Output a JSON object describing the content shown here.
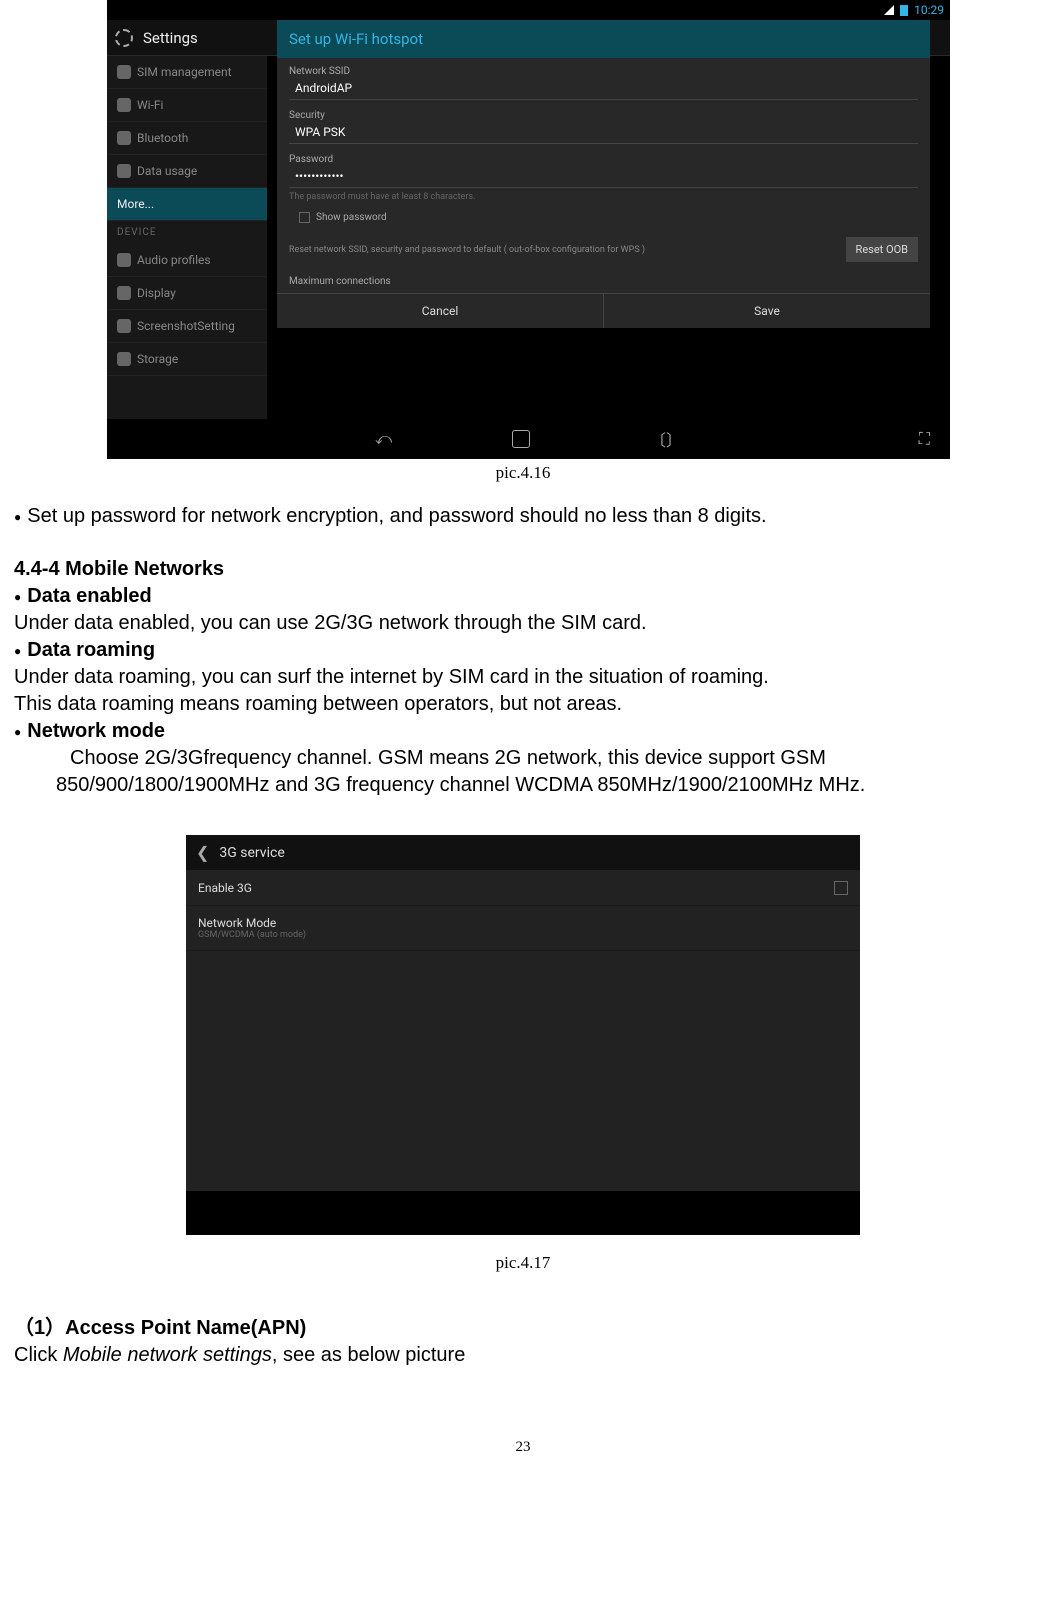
{
  "shot1": {
    "statusbar": {
      "time": "10:29"
    },
    "settings_title": "Settings",
    "sidebar": {
      "items": [
        {
          "label": "SIM management"
        },
        {
          "label": "Wi-Fi"
        },
        {
          "label": "Bluetooth"
        },
        {
          "label": "Data usage"
        },
        {
          "label": "More..."
        }
      ],
      "device_header": "DEVICE",
      "device_items": [
        {
          "label": "Audio profiles"
        },
        {
          "label": "Display"
        },
        {
          "label": "ScreenshotSetting"
        },
        {
          "label": "Storage"
        }
      ]
    },
    "dialog": {
      "title": "Set up Wi-Fi hotspot",
      "ssid_label": "Network SSID",
      "ssid_value": "AndroidAP",
      "security_label": "Security",
      "security_value": "WPA PSK",
      "password_label": "Password",
      "password_value": "••••••••••••",
      "password_hint": "The password must have at least 8 characters.",
      "show_password": "Show password",
      "reset_text": "Reset network SSID, security and password to default ( out-of-box configuration for WPS )",
      "reset_btn": "Reset OOB",
      "max_conn": "Maximum connections",
      "cancel": "Cancel",
      "save": "Save"
    }
  },
  "caption1": "pic.4.16",
  "doc": {
    "setup_pw": "Set up password for network encryption, and password should no less than 8 digits.",
    "section_444": "4.4-4 Mobile Networks",
    "data_enabled_h": "Data enabled",
    "data_enabled_t": "Under data enabled, you can use 2G/3G network through the SIM card.",
    "data_roaming_h": "Data roaming",
    "data_roaming_t1": "Under data roaming, you can surf the internet by SIM card in the situation of roaming.",
    "data_roaming_t2": "This data roaming means roaming between operators, but not areas.",
    "network_mode_h": "Network mode",
    "network_mode_t1": "Choose 2G/3Gfrequency channel. GSM means 2G network, this device support GSM",
    "network_mode_t2": "850/900/1800/1900MHz and 3G frequency channel WCDMA 850MHz/1900/2100MHz MHz.",
    "apn_h": "（1）Access Point Name(APN)",
    "apn_t_pre": "Click ",
    "apn_t_italic": "Mobile network settings",
    "apn_t_post": ", see as below picture"
  },
  "shot2": {
    "title": "3G service",
    "row1": "Enable 3G",
    "row2_label": "Network Mode",
    "row2_sub": "GSM/WCDMA (auto mode)"
  },
  "caption2": "pic.4.17",
  "page_number": "23"
}
